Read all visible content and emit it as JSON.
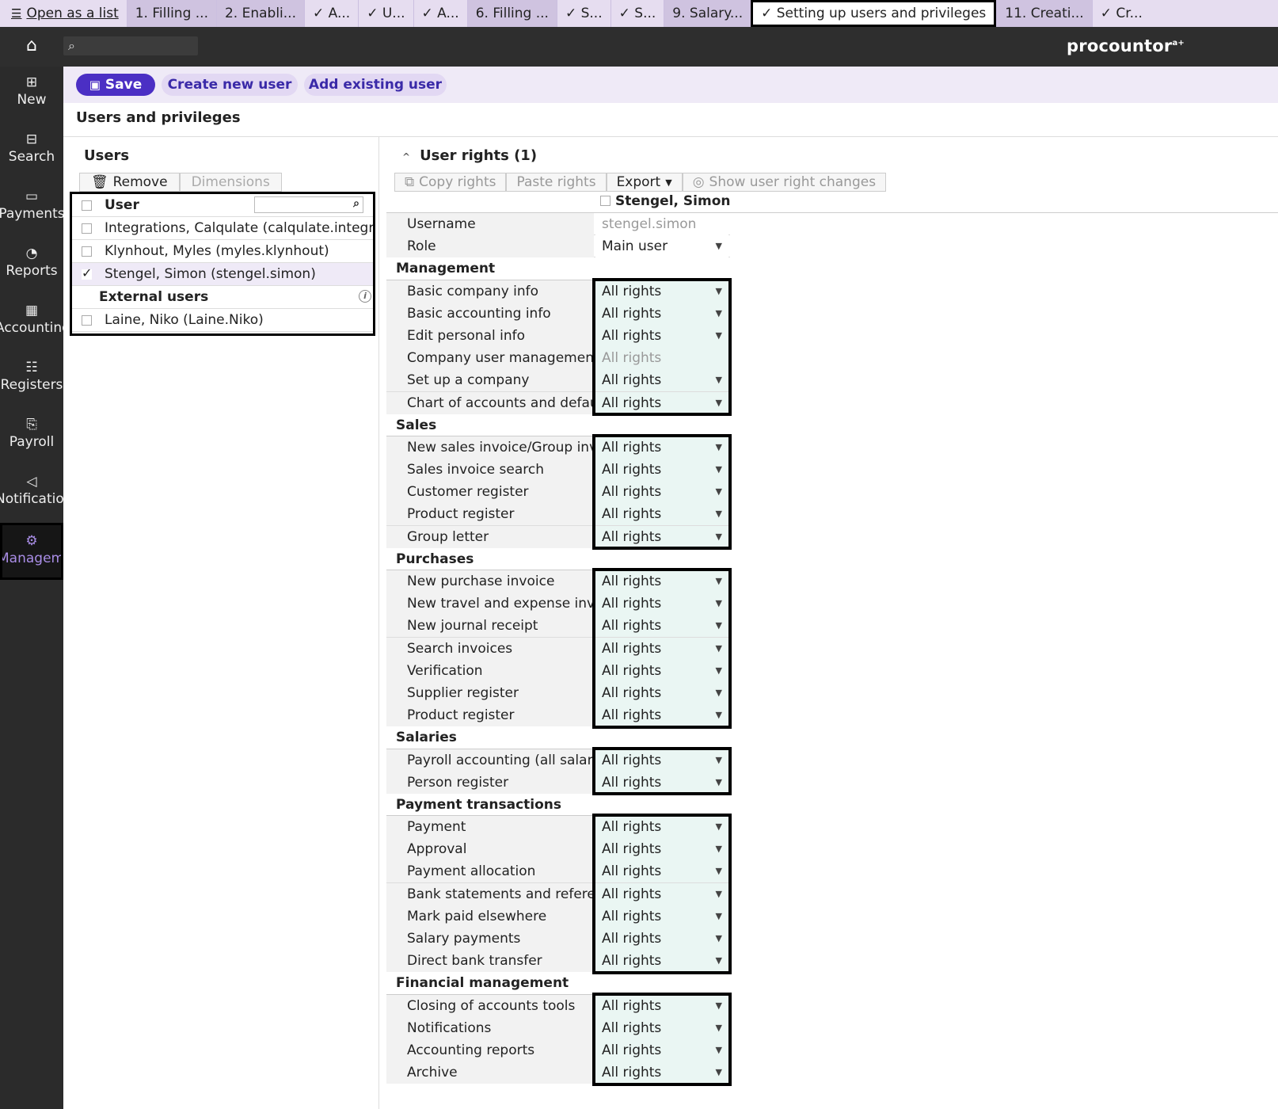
{
  "tabstrip": {
    "open_list": "Open as a list",
    "tabs": [
      {
        "label": "1. Filling ...",
        "style": "grey"
      },
      {
        "label": "2. Enabli...",
        "style": "grey"
      },
      {
        "label": "✓ A...",
        "style": ""
      },
      {
        "label": "✓ U...",
        "style": ""
      },
      {
        "label": "✓ A...",
        "style": ""
      },
      {
        "label": "6. Filling ...",
        "style": "grey"
      },
      {
        "label": "✓ S...",
        "style": ""
      },
      {
        "label": "✓ S...",
        "style": ""
      },
      {
        "label": "9. Salary...",
        "style": "grey"
      },
      {
        "label": "✓ Setting up users and privileges",
        "style": "active"
      },
      {
        "label": "11. Creati...",
        "style": "grey"
      },
      {
        "label": "✓ Cr...",
        "style": ""
      }
    ]
  },
  "header": {
    "logo": "procountor",
    "logo_sup": "a+",
    "home_icon": "home-icon",
    "search_icon": "search-icon"
  },
  "sidebar": {
    "items": [
      {
        "label": "New",
        "icon": "⊞",
        "active": false
      },
      {
        "label": "Search",
        "icon": "⊟",
        "active": false
      },
      {
        "label": "Payments",
        "icon": "▭",
        "active": false
      },
      {
        "label": "Reports",
        "icon": "◔",
        "active": false
      },
      {
        "label": "Accounting",
        "icon": "▦",
        "active": false
      },
      {
        "label": "Registers",
        "icon": "☷",
        "active": false
      },
      {
        "label": "Payroll",
        "icon": "⎘",
        "active": false
      },
      {
        "label": "Notifications",
        "icon": "◁",
        "active": false
      },
      {
        "label": "Management",
        "icon": "⚙",
        "active": true
      }
    ]
  },
  "actions": {
    "save": "Save",
    "create": "Create new user",
    "add": "Add existing user"
  },
  "page_title": "Users and privileges",
  "users": {
    "title": "Users",
    "remove": "Remove",
    "dimensions": "Dimensions",
    "column": "User",
    "rows": [
      {
        "name": "Integrations, Calqulate (calqulate.integrations)",
        "checked": false
      },
      {
        "name": "Klynhout, Myles (myles.klynhout)",
        "checked": false
      },
      {
        "name": "Stengel, Simon (stengel.simon)",
        "checked": true
      }
    ],
    "external_label": "External users",
    "external_rows": [
      {
        "name": "Laine, Niko (Laine.Niko)",
        "checked": false
      }
    ]
  },
  "rights": {
    "title": "User rights (1)",
    "copy": "Copy rights",
    "paste": "Paste rights",
    "export": "Export",
    "show_changes": "Show user right changes",
    "user_column": "Stengel, Simon",
    "username_label": "Username",
    "username_value": "stengel.simon",
    "role_label": "Role",
    "role_value": "Main user",
    "sections": [
      {
        "title": "Management",
        "rows": [
          {
            "label": "Basic company info",
            "value": "All rights",
            "dim": false
          },
          {
            "label": "Basic accounting info",
            "value": "All rights",
            "dim": false
          },
          {
            "label": "Edit personal info",
            "value": "All rights",
            "dim": false
          },
          {
            "label": "Company user management",
            "value": "All rights",
            "dim": true
          },
          {
            "label": "Set up a company",
            "value": "All rights",
            "dim": false
          },
          {
            "label": "Chart of accounts and default",
            "value": "All rights",
            "dim": false
          }
        ]
      },
      {
        "title": "Sales",
        "rows": [
          {
            "label": "New sales invoice/Group invoice",
            "value": "All rights",
            "dim": false
          },
          {
            "label": "Sales invoice search",
            "value": "All rights",
            "dim": false
          },
          {
            "label": "Customer register",
            "value": "All rights",
            "dim": false
          },
          {
            "label": "Product register",
            "value": "All rights",
            "dim": false
          },
          {
            "label": "Group letter",
            "value": "All rights",
            "dim": false
          }
        ]
      },
      {
        "title": "Purchases",
        "rows": [
          {
            "label": "New purchase invoice",
            "value": "All rights",
            "dim": false
          },
          {
            "label": "New travel and expense invoice",
            "value": "All rights",
            "dim": false
          },
          {
            "label": "New journal receipt",
            "value": "All rights",
            "dim": false
          },
          {
            "label": "Search invoices",
            "value": "All rights",
            "dim": false
          },
          {
            "label": "Verification",
            "value": "All rights",
            "dim": false
          },
          {
            "label": "Supplier register",
            "value": "All rights",
            "dim": false
          },
          {
            "label": "Product register",
            "value": "All rights",
            "dim": false
          }
        ]
      },
      {
        "title": "Salaries",
        "rows": [
          {
            "label": "Payroll accounting (all salary",
            "value": "All rights",
            "dim": false
          },
          {
            "label": "Person register",
            "value": "All rights",
            "dim": false
          }
        ]
      },
      {
        "title": "Payment transactions",
        "rows": [
          {
            "label": "Payment",
            "value": "All rights",
            "dim": false
          },
          {
            "label": "Approval",
            "value": "All rights",
            "dim": false
          },
          {
            "label": "Payment allocation",
            "value": "All rights",
            "dim": false
          },
          {
            "label": "Bank statements and reference",
            "value": "All rights",
            "dim": false
          },
          {
            "label": "Mark paid elsewhere",
            "value": "All rights",
            "dim": false
          },
          {
            "label": "Salary payments",
            "value": "All rights",
            "dim": false
          },
          {
            "label": "Direct bank transfer",
            "value": "All rights",
            "dim": false
          }
        ]
      },
      {
        "title": "Financial management",
        "rows": [
          {
            "label": "Closing of accounts tools",
            "value": "All rights",
            "dim": false
          },
          {
            "label": "Notifications",
            "value": "All rights",
            "dim": false
          },
          {
            "label": "Accounting reports",
            "value": "All rights",
            "dim": false
          },
          {
            "label": "Archive",
            "value": "All rights",
            "dim": false
          }
        ]
      }
    ]
  },
  "colors": {
    "brand": "#4b2fc4",
    "accent_light": "#e2d8f3",
    "sidebar": "#2b2b2b",
    "active_nav": "#a98de6",
    "rights_cell": "#eaf6f3"
  }
}
